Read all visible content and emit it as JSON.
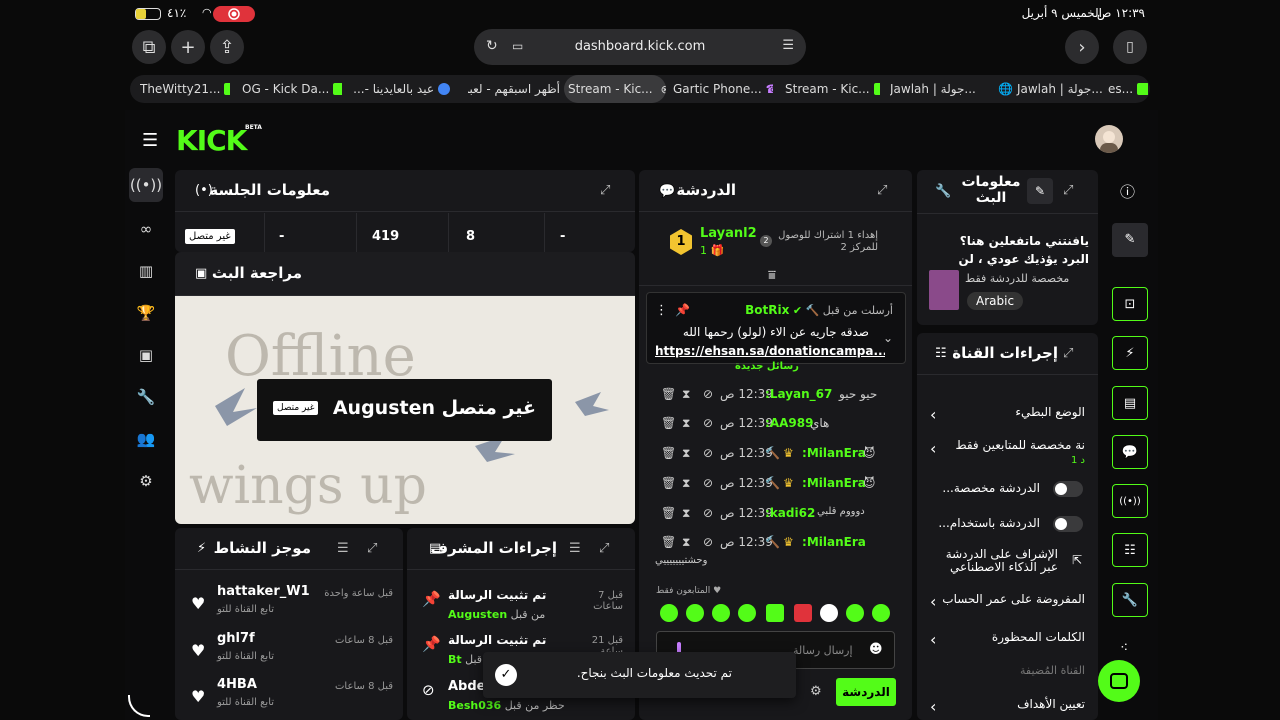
{
  "status": {
    "time": "١٢:٣٩ ص",
    "date": "الخميس ٩ أبريل",
    "battery": "٤١٪"
  },
  "browser": {
    "url": "dashboard.kick.com",
    "tabs": [
      {
        "label": "TheWitty21..."
      },
      {
        "label": "OG - Kick Da..."
      },
      {
        "label": "عيد بالعايدينا -..."
      },
      {
        "label": "أظهر  اسبقهم - لعبة تـ"
      },
      {
        "label": "Stream - Kic..."
      },
      {
        "label": "Gartic Phone..."
      },
      {
        "label": "Stream - Kic..."
      },
      {
        "label": "Jawlah | جولة..."
      },
      {
        "label": "Jawlah | جولة..."
      },
      {
        "label": "es..."
      }
    ]
  },
  "app": {
    "logo": "KICK",
    "beta": "BETA"
  },
  "session": {
    "title": "معلومات الجلسة",
    "offline_badge": "غير متصل",
    "cells": [
      "-",
      "419",
      "8",
      "-"
    ]
  },
  "stream_review": {
    "title": "مراجعة البث",
    "offline_line1": "Offline",
    "offline_line2": "wings up",
    "overlay_name": "غير متصل Augusten",
    "overlay_badge": "غير متصل"
  },
  "activity": {
    "title": "موجز النشاط",
    "items": [
      {
        "name": "hattaker_W1",
        "sub": "تابع القناة للتو",
        "time": "قبل ساعة واحدة"
      },
      {
        "name": "ghl7f",
        "sub": "تابع القناة للتو",
        "time": "قبل 8 ساعات"
      },
      {
        "name": "4HBA",
        "sub": "تابع القناة للتو",
        "time": "قبل 8 ساعات"
      }
    ]
  },
  "mod_actions": {
    "title": "إجراءات المشرف",
    "items": [
      {
        "action": "تم تثبيت الرسالة",
        "by": "من قبل",
        "user": "Augusten",
        "time": "قبل 7 ساعات"
      },
      {
        "action": "تم تثبيت الرسالة",
        "by": "من قبل",
        "user": "Bt",
        "time": "قبل 21 ساعة"
      },
      {
        "action": "Abdel",
        "by": "حظر من قبل",
        "user": "Besh036",
        "time": ""
      }
    ]
  },
  "chat": {
    "title": "الدردشة",
    "gifter_name": "Layanl2",
    "gifter_count": "1",
    "gift_text": "إهداء 1 اشتراك للوصول للمركز 2",
    "gift_rank": "2",
    "gift_badge": "1",
    "pinned": {
      "user": "BotRix",
      "sent_by": "أرسلت من قبل",
      "text": "صدقه جاريه عن الاء (لولو) رحمها الله",
      "link": "https://ehsan.sa/donationcampa..."
    },
    "new_messages": "رسائل جديدة",
    "messages": [
      {
        "time": "12:39 ص",
        "user": "Layan_67:",
        "text": "حيو حيو"
      },
      {
        "time": "12:39 ص",
        "user": "AA989:",
        "text": "هاي"
      },
      {
        "time": "12:39 ص",
        "user": "MilanEra:",
        "text": "😈"
      },
      {
        "time": "12:39 ص",
        "user": "MilanEra:",
        "text": "😈"
      },
      {
        "time": "12:39 ص",
        "user": "kadi62:",
        "text": "دوووم قلبي"
      },
      {
        "time": "12:39 ص",
        "user": "MilanEra:",
        "text": "وحشتيييييييي"
      }
    ],
    "followers_only": "المتابعون فقط",
    "input_placeholder": "إرسال رسالة",
    "send_label": "الدردشة"
  },
  "stream_info": {
    "title": "معلومات البث",
    "stream_title": "يافنتني ماتفعلين هنا؟ البرد يؤذيك عودي ، لن اعود انا |...",
    "category": "مخصصة للدردشة فقط",
    "language": "Arabic"
  },
  "channel_actions": {
    "title": "إجراءات القناة",
    "items": [
      {
        "label": "الوضع البطيء",
        "type": "arrow"
      },
      {
        "label": "نة مخصصة للمتابعين فقط",
        "sub": "د 1",
        "type": "arrow"
      },
      {
        "label": "الدردشة مخصصة...",
        "type": "toggle"
      },
      {
        "label": "الدردشة باستخدام...",
        "type": "toggle"
      },
      {
        "label": "الإشراف على الدردشة عبر الذكاء الاصطناعي",
        "type": "link"
      },
      {
        "label": "المفروضة على عمر الحساب",
        "type": "arrow"
      },
      {
        "label": "الكلمات المحظورة",
        "type": "arrow"
      }
    ],
    "hosted_label": "القناة المُضيفة",
    "goals_label": "تعيين الأهداف"
  },
  "toast": "تم تحديث معلومات البث بنجاح."
}
